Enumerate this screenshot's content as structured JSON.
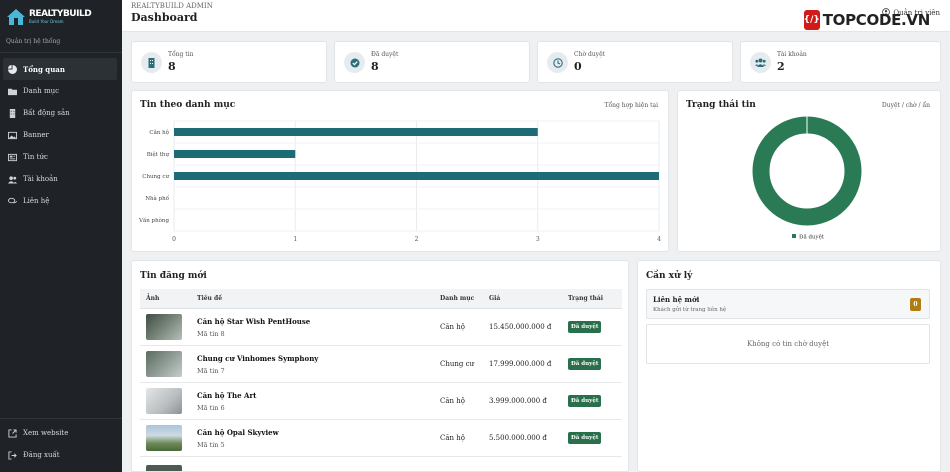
{
  "sidebar": {
    "logo_text": "REALTYBUILD",
    "logo_sub": "Build Your Dream",
    "caption": "Quản trị hệ thống",
    "items": [
      {
        "label": "Tổng quan",
        "icon": "pie-chart-icon",
        "active": true
      },
      {
        "label": "Danh mục",
        "icon": "folder-icon"
      },
      {
        "label": "Bất động sản",
        "icon": "building-icon"
      },
      {
        "label": "Banner",
        "icon": "image-icon"
      },
      {
        "label": "Tin tức",
        "icon": "newspaper-icon"
      },
      {
        "label": "Tài khoản",
        "icon": "users-icon"
      },
      {
        "label": "Liên hệ",
        "icon": "chat-icon"
      }
    ],
    "bottom": [
      {
        "label": "Xem website",
        "icon": "external-link-icon"
      },
      {
        "label": "Đăng xuất",
        "icon": "logout-icon"
      }
    ]
  },
  "topbar": {
    "subtitle": "REALTYBUILD ADMIN",
    "title": "Dashboard",
    "user_label": "Quản trị viên"
  },
  "watermark": {
    "brand_text": "TOPCODE.VN"
  },
  "stats": [
    {
      "label": "Tổng tin",
      "value": "8",
      "icon": "building-icon",
      "color": "#2a6f7a"
    },
    {
      "label": "Đã duyệt",
      "value": "8",
      "icon": "check-circle-icon",
      "color": "#2a6f7a"
    },
    {
      "label": "Chờ duyệt",
      "value": "0",
      "icon": "clock-icon",
      "color": "#2a6f7a"
    },
    {
      "label": "Tài khoản",
      "value": "2",
      "icon": "users-icon",
      "color": "#2a6f7a"
    }
  ],
  "category_chart": {
    "title": "Tin theo danh mục",
    "hint": "Tổng hợp hiện tại"
  },
  "status_chart": {
    "title": "Trạng thái tin",
    "hint": "Duyệt / chờ / ẩn"
  },
  "chart_data": [
    {
      "type": "bar",
      "orientation": "horizontal",
      "categories": [
        "Căn hộ",
        "Biệt thự",
        "Chung cư",
        "Nhà phố",
        "Văn phòng"
      ],
      "values": [
        3,
        1,
        4,
        0,
        0
      ],
      "xlim": [
        0,
        4
      ],
      "xticks": [
        "0",
        "1",
        "2",
        "3",
        "4"
      ],
      "color": "#1d6b75",
      "grid": true
    },
    {
      "type": "pie",
      "style": "doughnut",
      "labels": [
        "Đã duyệt"
      ],
      "values": [
        8
      ],
      "colors": [
        "#2a7a56"
      ],
      "legend": "bottom"
    }
  ],
  "recent": {
    "title": "Tin đăng mới",
    "columns": [
      "Ảnh",
      "Tiêu đề",
      "Danh mục",
      "Giá",
      "Trạng thái"
    ],
    "rows": [
      {
        "title": "Căn hộ Star Wish PentHouse",
        "code": "Mã tin 8",
        "category": "Căn hộ",
        "price": "15.450.000.000 đ",
        "status": "Đã duyệt",
        "thumb": "#5b6a5e"
      },
      {
        "title": "Chung cư Vinhomes Symphony",
        "code": "Mã tin 7",
        "category": "Chung cư",
        "price": "17.999.000.000 đ",
        "status": "Đã duyệt",
        "thumb": "#6e7a72"
      },
      {
        "title": "Căn hộ The Art",
        "code": "Mã tin 6",
        "category": "Căn hộ",
        "price": "3.999.000.000 đ",
        "status": "Đã duyệt",
        "thumb": "#c9ccce"
      },
      {
        "title": "Căn hộ Opal Skyview",
        "code": "Mã tin 5",
        "category": "Căn hộ",
        "price": "5.500.000.000 đ",
        "status": "Đã duyệt",
        "thumb": "#7a8c6a"
      }
    ]
  },
  "pending": {
    "title": "Cần xử lý",
    "contact_title": "Liên hệ mới",
    "contact_sub": "Khách gửi từ trang liên hệ",
    "contact_count": "0",
    "empty_text": "Không có tin chờ duyệt"
  }
}
